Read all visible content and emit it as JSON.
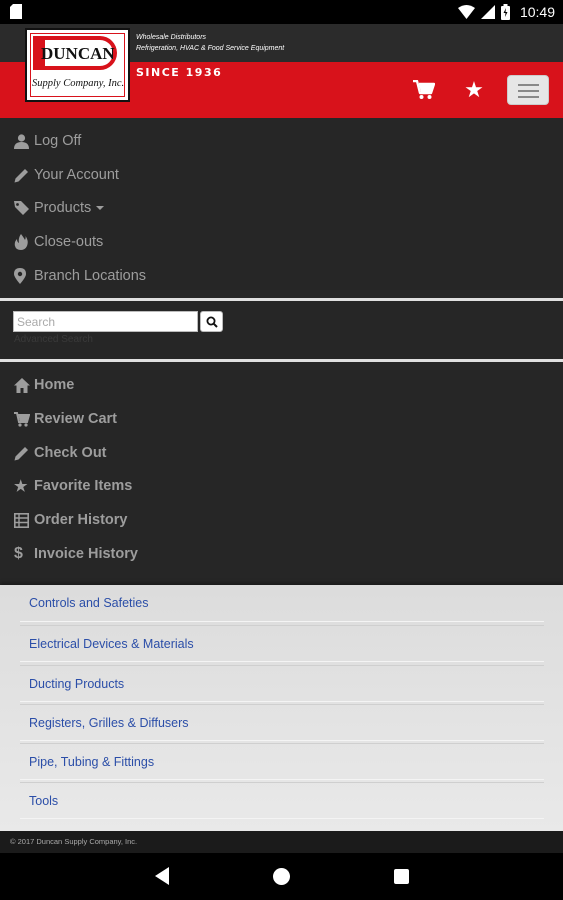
{
  "status_bar": {
    "time": "10:49"
  },
  "header": {
    "brand_name": "DUNCAN",
    "brand_sub": "Supply Company, Inc.",
    "tagline_line1": "Wholesale Distributors",
    "tagline_line2": "Refrigeration, HVAC & Food Service Equipment",
    "since": "SINCE 1936"
  },
  "top_menu": [
    {
      "label": "Log Off",
      "icon": "user-icon"
    },
    {
      "label": "Your Account",
      "icon": "pencil-icon"
    },
    {
      "label": "Products",
      "icon": "tag-icon"
    },
    {
      "label": "Close-outs",
      "icon": "fire-icon"
    },
    {
      "label": "Branch Locations",
      "icon": "map-marker-icon"
    }
  ],
  "search": {
    "placeholder": "Search",
    "advanced_label": "Advanced Search"
  },
  "main_menu": [
    {
      "label": "Home",
      "icon": "home-icon"
    },
    {
      "label": "Review Cart",
      "icon": "cart-icon"
    },
    {
      "label": "Check Out",
      "icon": "pencil-icon"
    },
    {
      "label": "Favorite Items",
      "icon": "star-icon"
    },
    {
      "label": "Order History",
      "icon": "list-icon"
    },
    {
      "label": "Invoice History",
      "icon": "dollar-icon"
    }
  ],
  "products_dropdown": [
    "Controls and Safeties",
    "Electrical Devices & Materials",
    "Ducting Products",
    "Registers, Grilles & Diffusers",
    "Pipe, Tubing & Fittings",
    "Tools"
  ],
  "footer": {
    "copyright": "© 2017 Duncan Supply Company, Inc."
  }
}
